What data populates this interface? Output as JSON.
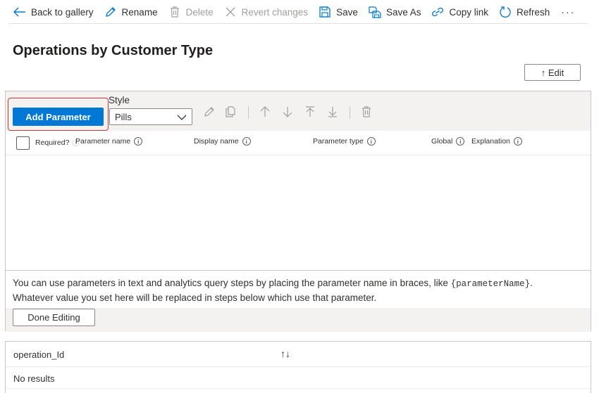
{
  "toolbar": {
    "back_label": "Back to gallery",
    "rename_label": "Rename",
    "delete_label": "Delete",
    "revert_label": "Revert changes",
    "save_label": "Save",
    "save_as_label": "Save As",
    "copy_link_label": "Copy link",
    "refresh_label": "Refresh",
    "more_label": "···"
  },
  "page": {
    "title": "Operations by Customer Type",
    "edit_label": "↑ Edit"
  },
  "parameters": {
    "add_button": "Add Parameter",
    "style_label": "Style",
    "style_value": "Pills",
    "columns": {
      "required": "Required?",
      "parameter_name": "Parameter name",
      "display_name": "Display name",
      "parameter_type": "Parameter type",
      "global": "Global",
      "explanation": "Explanation"
    },
    "help_line1_pre": "You can use parameters in text and analytics query steps by placing the parameter name in braces, like ",
    "help_code": "{parameterName}",
    "help_line1_post": ".",
    "help_line2": "Whatever value you set here will be replaced in steps below which use that parameter.",
    "done_button": "Done Editing"
  },
  "results": {
    "column": "operation_Id",
    "sort_icon": "↑↓",
    "empty_text": "No results"
  },
  "colors": {
    "accent": "#0078d4",
    "highlight": "#d13438"
  }
}
